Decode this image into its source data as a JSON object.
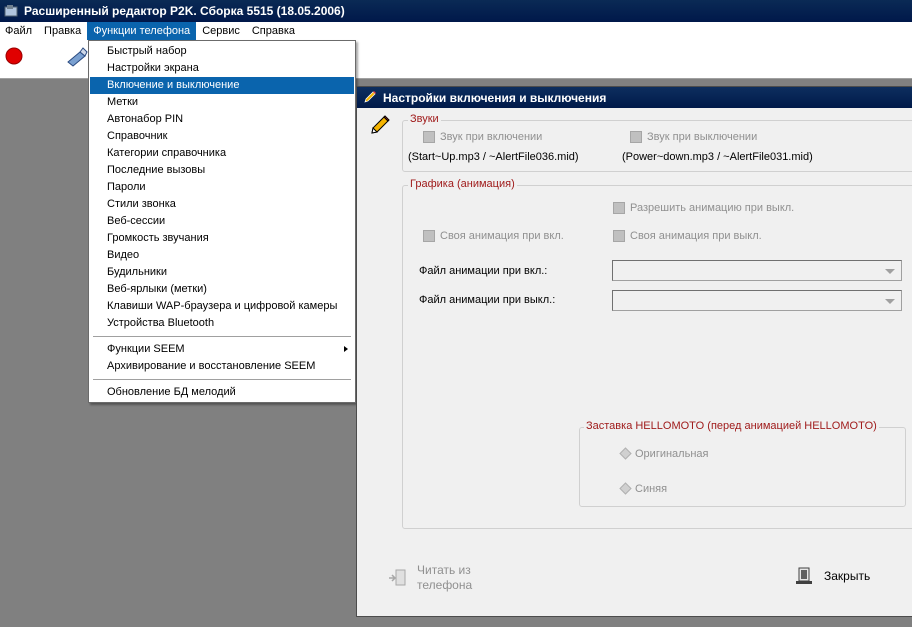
{
  "app": {
    "title": "Расширенный редактор P2K. Сборка 5515 (18.05.2006)"
  },
  "menubar": [
    {
      "label": "Файл"
    },
    {
      "label": "Правка"
    },
    {
      "label": "Функции телефона"
    },
    {
      "label": "Сервис"
    },
    {
      "label": "Справка"
    }
  ],
  "toolbar": {
    "icons": [
      "record-icon",
      "phone-connect-icon"
    ]
  },
  "dropdown": {
    "items": [
      {
        "label": "Быстрый набор"
      },
      {
        "label": "Настройки экрана"
      },
      {
        "label": "Включение и выключение"
      },
      {
        "label": "Метки"
      },
      {
        "label": "Автонабор PIN"
      },
      {
        "label": "Справочник"
      },
      {
        "label": "Категории справочника"
      },
      {
        "label": "Последние вызовы"
      },
      {
        "label": "Пароли"
      },
      {
        "label": "Стили звонка"
      },
      {
        "label": "Веб-сессии"
      },
      {
        "label": "Громкость звучания"
      },
      {
        "label": "Видео"
      },
      {
        "label": "Будильники"
      },
      {
        "label": "Веб-ярлыки (метки)"
      },
      {
        "label": "Клавиши WAP-браузера и цифровой камеры"
      },
      {
        "label": "Устройства Bluetooth"
      },
      {
        "label": "Функции SEEM"
      },
      {
        "label": "Архивирование и восстановление SEEM"
      },
      {
        "label": "Обновление БД мелодий"
      }
    ]
  },
  "dialog": {
    "title": "Настройки включения и выключения",
    "sounds": {
      "label": "Звуки",
      "on_checkbox": "Звук при включении",
      "off_checkbox": "Звук при выключении",
      "on_file": "(Start~Up.mp3 / ~AlertFile036.mid)",
      "off_file": "(Power~down.mp3 / ~AlertFile031.mid)"
    },
    "graphics": {
      "label": "Графика (анимация)",
      "allow_off_anim": "Разрешить анимацию при выкл.",
      "own_anim_on": "Своя анимация при вкл.",
      "own_anim_off": "Своя анимация при выкл.",
      "anim_file_on_label": "Файл анимации при вкл.:",
      "anim_file_off_label": "Файл анимации при выкл.:",
      "anim_file_on_value": "",
      "anim_file_off_value": ""
    },
    "splash": {
      "label": "Заставка HELLOMOTO (перед анимацией HELLOMOTO)",
      "original": "Оригинальная",
      "blue": "Синяя"
    },
    "buttons": {
      "read_line1": "Читать из",
      "read_line2": "телефона",
      "close": "Закрыть"
    }
  }
}
